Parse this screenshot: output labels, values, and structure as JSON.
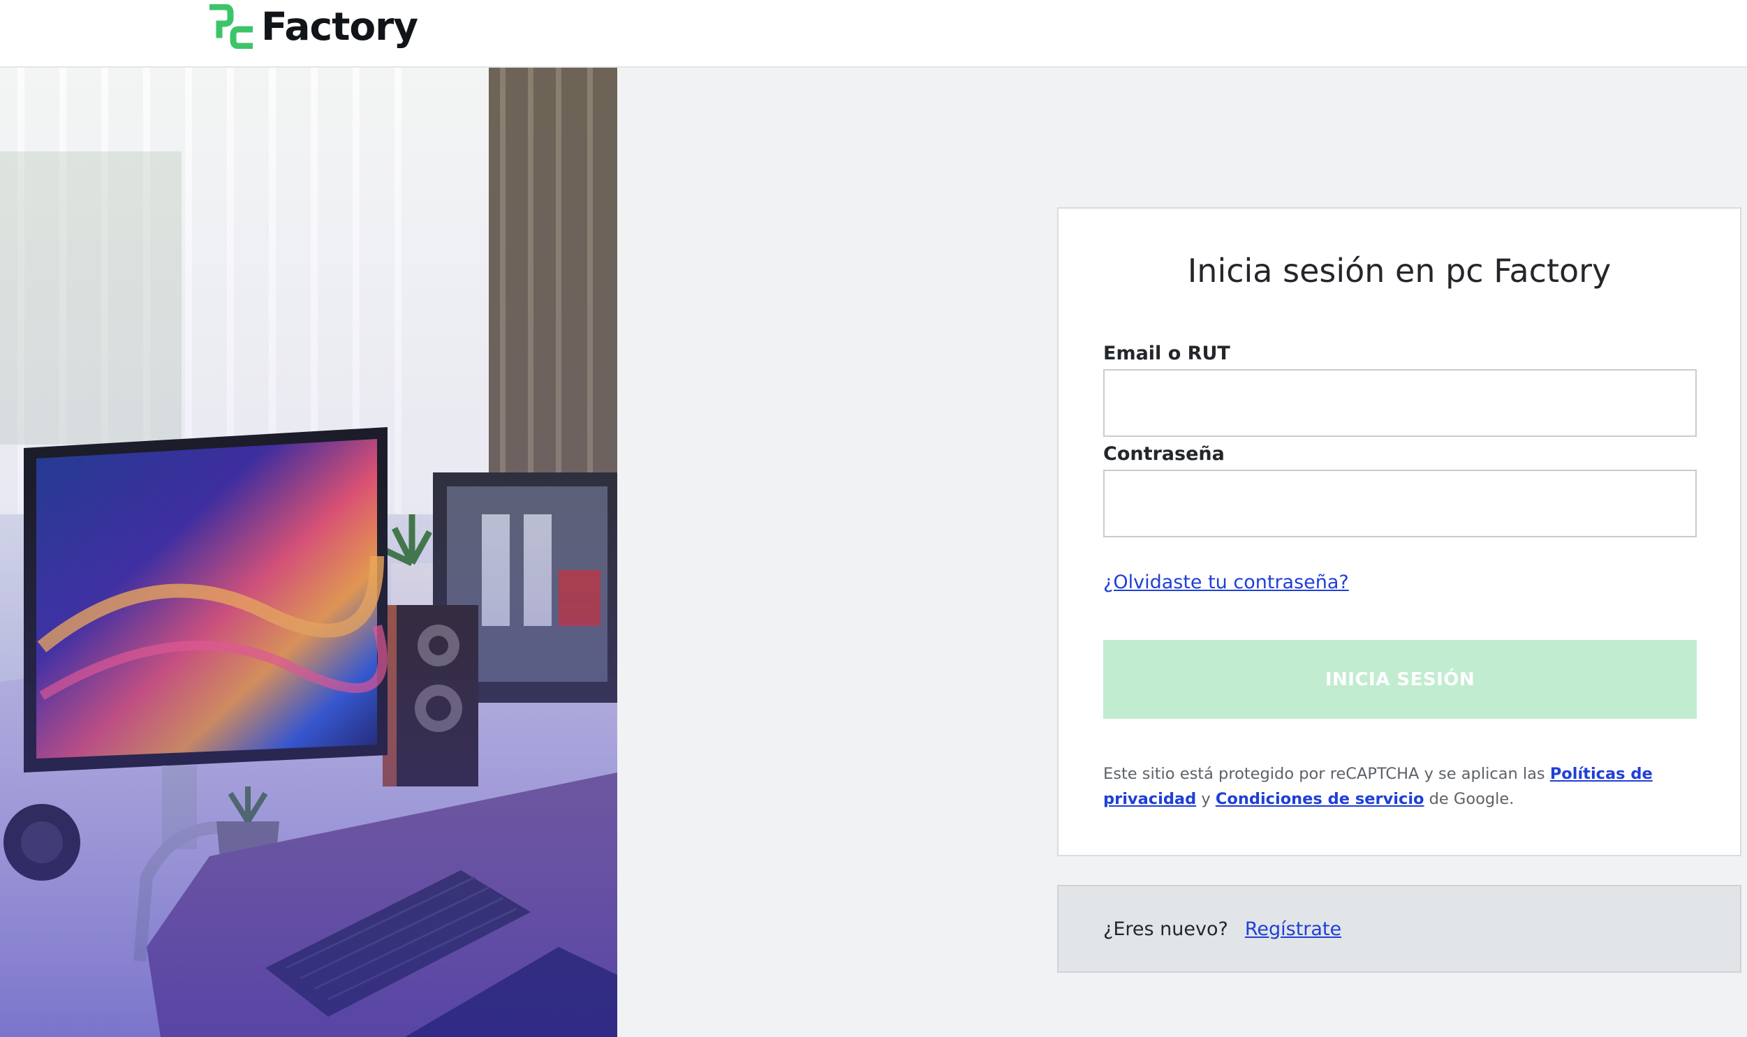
{
  "header": {
    "logo_text": "Factory",
    "logo_mark_icon": "pc-logo-mark-icon",
    "brand_green": "#3dc46a"
  },
  "hero": {
    "image": "desk-setup-photo"
  },
  "login": {
    "title": "Inicia sesión en pc Factory",
    "email_label": "Email o RUT",
    "email_value": "",
    "password_label": "Contraseña",
    "password_value": "",
    "forgot_link": "¿Olvidaste tu contraseña?",
    "submit_label": "INICIA SESIÓN",
    "submit_color": "#c1ecd0",
    "recaptcha": {
      "prefix": "Este sitio está protegido por reCAPTCHA y se aplican las ",
      "privacy_link": "Políticas de privacidad",
      "middle": " y ",
      "terms_link": "Condiciones de servicio",
      "suffix": " de Google."
    }
  },
  "register": {
    "question": "¿Eres nuevo?",
    "link": "Regístrate"
  },
  "colors": {
    "link": "#1f3fd6",
    "page_bg": "#f1f2f4"
  }
}
